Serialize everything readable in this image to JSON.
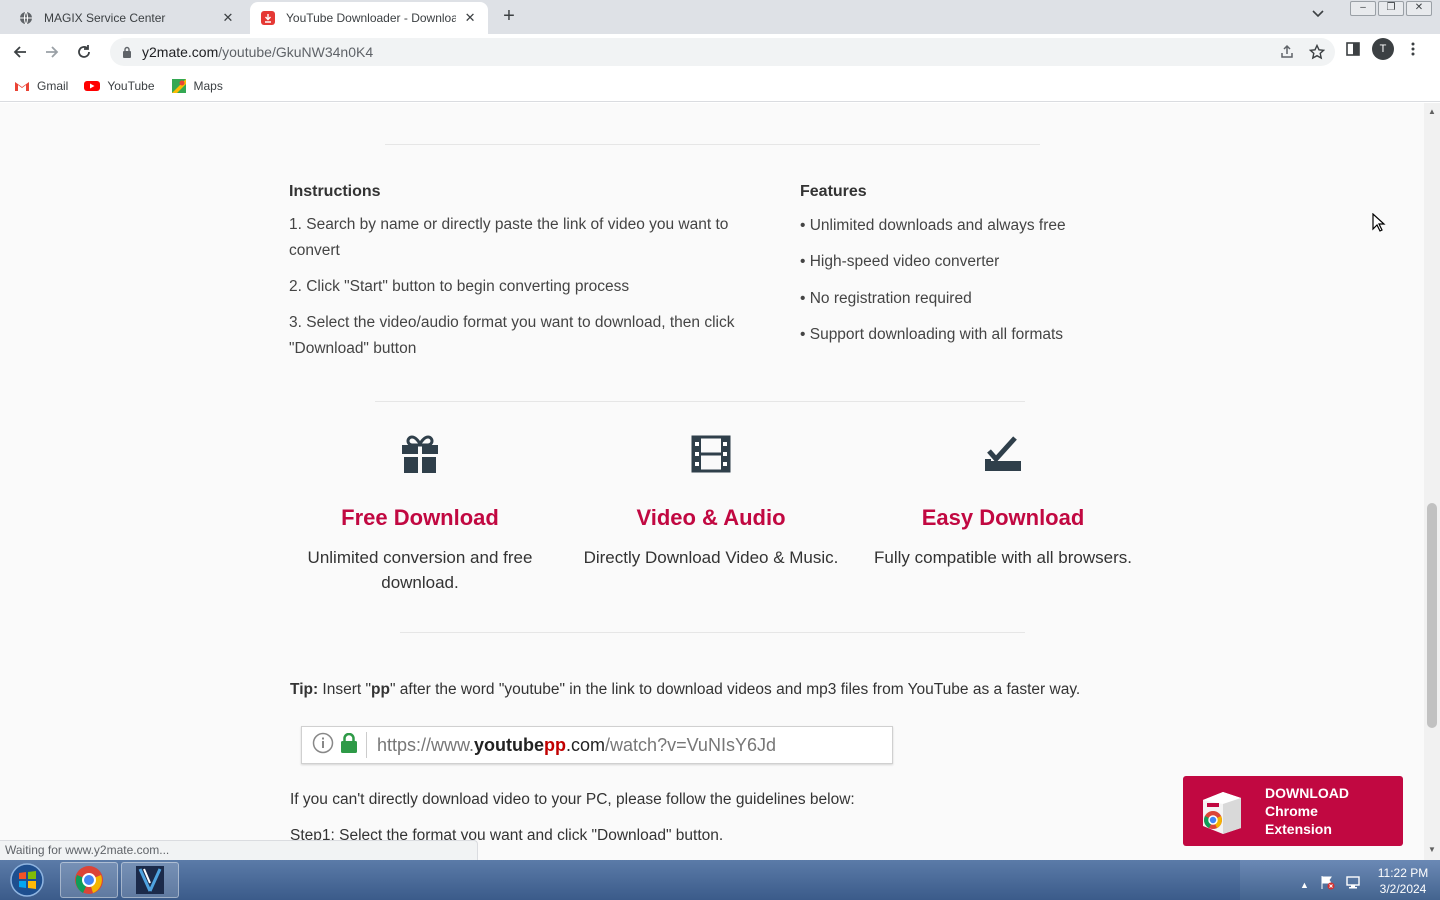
{
  "browser": {
    "tabs": [
      {
        "title": "MAGIX Service Center",
        "active": false
      },
      {
        "title": "YouTube Downloader - Downloa",
        "active": true
      }
    ],
    "url_domain": "y2mate.com",
    "url_path": "/youtube/GkuNW34n0K4",
    "profile_initial": "T",
    "bookmarks": [
      {
        "label": "Gmail"
      },
      {
        "label": "YouTube"
      },
      {
        "label": "Maps"
      }
    ],
    "status_text": "Waiting for www.y2mate.com..."
  },
  "instructions": {
    "title": "Instructions",
    "steps": [
      "1. Search by name or directly paste the link of video you want to convert",
      "2. Click \"Start\" button to begin converting process",
      "3. Select the video/audio format you want to download, then click \"Download\" button"
    ]
  },
  "features": {
    "title": "Features",
    "items": [
      "• Unlimited downloads and always free",
      "• High-speed video converter",
      "• No registration required",
      "• Support downloading with all formats"
    ]
  },
  "highlights": [
    {
      "icon": "gift-icon",
      "title": "Free Download",
      "desc": "Unlimited conversion and free download."
    },
    {
      "icon": "film-icon",
      "title": "Video & Audio",
      "desc": "Directly Download Video & Music."
    },
    {
      "icon": "check-download-icon",
      "title": "Easy Download",
      "desc": "Fully compatible with all browsers."
    }
  ],
  "tip": {
    "label": "Tip:",
    "text_before": " Insert \"",
    "keyword": "pp",
    "text_after": "\" after the word \"youtube\" in the link to download videos and mp3 files from YouTube as a faster way."
  },
  "example_url": {
    "part1": "https://www.",
    "part2": "youtube",
    "part3": "pp",
    "part4": ".com",
    "part5": "/watch?v=VuNIsY6Jd"
  },
  "guide_text": "If you can't directly download video to your PC, please follow the guidelines below:",
  "step1_text": "Step1: Select the format you want and click \"Download\" button.",
  "extension_banner": {
    "line1": "DOWNLOAD",
    "line2": "Chrome",
    "line3": "Extension"
  },
  "taskbar": {
    "time": "11:22 PM",
    "date": "3/2/2024"
  },
  "colors": {
    "accent": "#c10841"
  }
}
